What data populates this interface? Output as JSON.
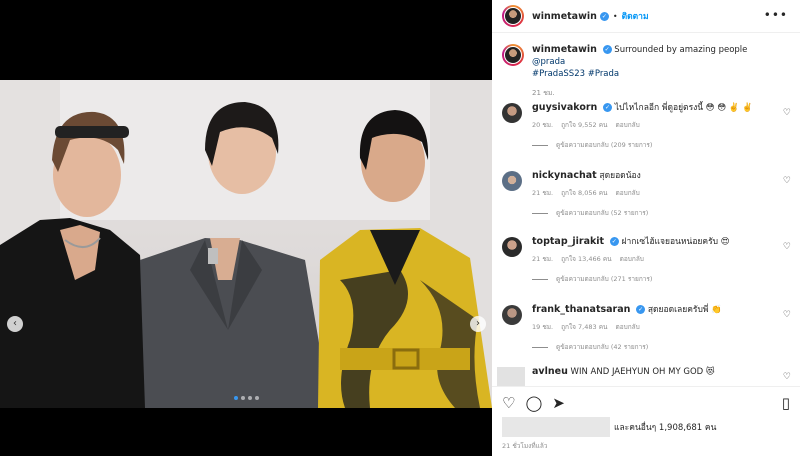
{
  "post": {
    "username": "winmetawin",
    "follow_label": "ติดตาม",
    "more_label": "•••",
    "caption_text": "Surrounded by amazing people",
    "caption_mention": "@prada",
    "caption_tags": "#PradaSS23 #Prada",
    "caption_time": "21 ชม.",
    "likes_text": "และคนอื่นๆ 1,908,681 คน",
    "posted_ago": "21 ชั่วโมงที่แล้ว",
    "photo_dots": 4,
    "photo_active_dot": 1
  },
  "comments": [
    {
      "username": "guysivakorn",
      "text": "ไปไหไกลอีก พี่ดูอยู่ตรงนี้ 😳 😳 ✌️ ✌️",
      "time": "20 ชม.",
      "likes": "ถูกใจ 9,552 คน",
      "reply": "ตอบกลับ",
      "replies": "ดูข้อความตอบกลับ (209 รายการ)",
      "verified": true
    },
    {
      "username": "nickynachat",
      "text": "สุดยอดน้อง",
      "time": "21 ชม.",
      "likes": "ถูกใจ 8,056 คน",
      "reply": "ตอบกลับ",
      "replies": "ดูข้อความตอบกลับ (52 รายการ)",
      "verified": false
    },
    {
      "username": "toptap_jirakit",
      "text": "ฝากเซไฮ้แจยอนหน่อยครับ 😍",
      "time": "21 ชม.",
      "likes": "ถูกใจ 13,466 คน",
      "reply": "ตอบกลับ",
      "replies": "ดูข้อความตอบกลับ (271 รายการ)",
      "verified": true
    },
    {
      "username": "frank_thanatsaran",
      "text": "สุดยอดเลยครับพี่ 👏",
      "time": "19 ชม.",
      "likes": "ถูกใจ 7,483 คน",
      "reply": "ตอบกลับ",
      "replies": "ดูข้อความตอบกลับ (42 รายการ)",
      "verified": true
    },
    {
      "username": "avlneu",
      "text": "WIN AND JAEHYUN OH MY GOD 😻",
      "verified": false
    }
  ],
  "icons": {
    "verified": "✓",
    "prev": "‹",
    "next": "›",
    "heart": "♡",
    "like": "♡",
    "comment": "◯",
    "share": "➤",
    "save": "▯"
  },
  "colors": {
    "accent": "#0095f6",
    "verified": "#3897f0",
    "muted": "#8e8e8e",
    "text": "#262626"
  }
}
